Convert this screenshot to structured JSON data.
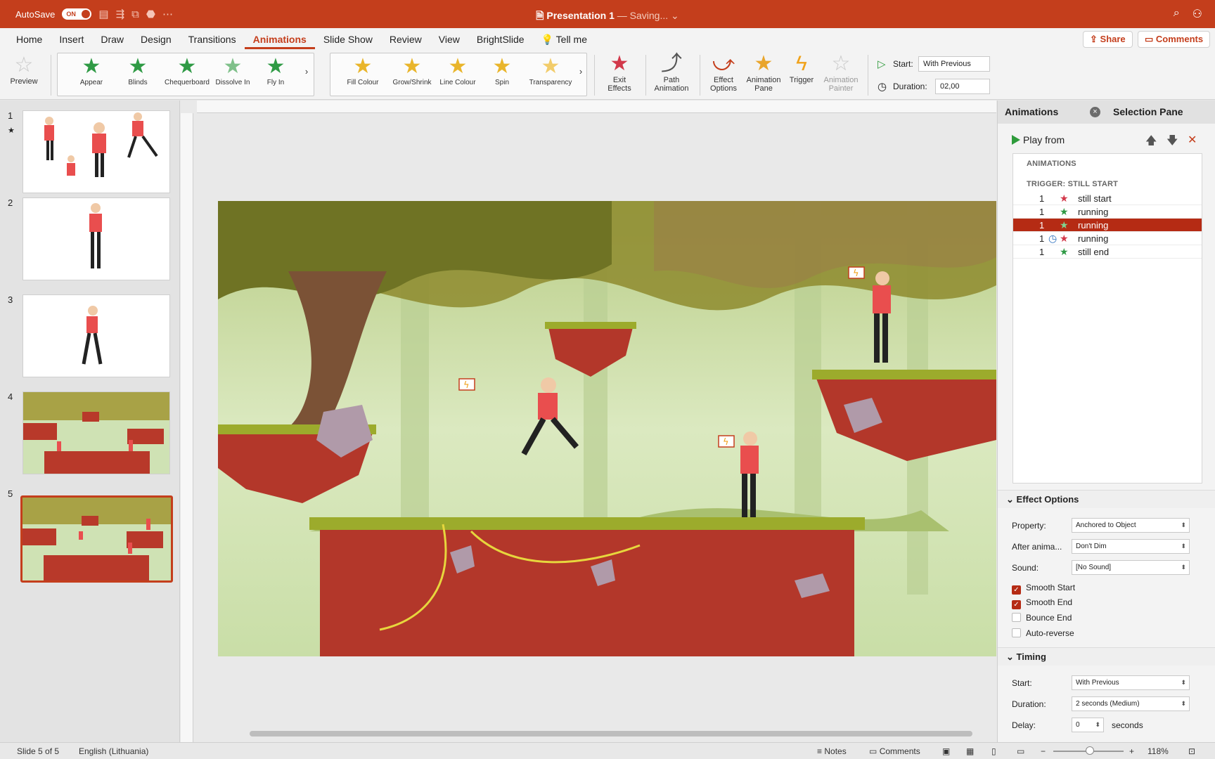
{
  "titlebar": {
    "autosave_label": "AutoSave",
    "autosave_state": "ON",
    "doc_title": "Presentation 1",
    "save_status": "— Saving...",
    "brand_color": "#c43e1c"
  },
  "menu": {
    "tabs": [
      "Home",
      "Insert",
      "Draw",
      "Design",
      "Transitions",
      "Animations",
      "Slide Show",
      "Review",
      "View",
      "BrightSlide",
      "Tell me"
    ],
    "active_tab": "Animations",
    "share_label": "Share",
    "comments_label": "Comments"
  },
  "ribbon": {
    "preview_label": "Preview",
    "entrance_effects": [
      "Appear",
      "Blinds",
      "Chequerboard",
      "Dissolve In",
      "Fly In"
    ],
    "emphasis_effects": [
      "Fill Colour",
      "Grow/Shrink",
      "Line Colour",
      "Spin",
      "Transparency"
    ],
    "exit_label_1": "Exit",
    "exit_label_2": "Effects",
    "path_label_1": "Path",
    "path_label_2": "Animation",
    "effect_options_1": "Effect",
    "effect_options_2": "Options",
    "animation_pane_1": "Animation",
    "animation_pane_2": "Pane",
    "trigger_label": "Trigger",
    "painter_1": "Animation",
    "painter_2": "Painter",
    "start_label": "Start:",
    "start_value": "With Previous",
    "duration_label": "Duration:",
    "duration_value": "02,00"
  },
  "slides": {
    "numbers": [
      "1",
      "2",
      "3",
      "4",
      "5"
    ],
    "selected": "5"
  },
  "pane": {
    "tab_animations": "Animations",
    "tab_selection": "Selection Pane",
    "play_from": "Play from",
    "list_header": "ANIMATIONS",
    "trigger_header": "TRIGGER: STILL START",
    "items": [
      {
        "num": "1",
        "label": "still start",
        "icon": "exit-star-icon"
      },
      {
        "num": "1",
        "label": "running",
        "icon": "entrance-star-icon"
      },
      {
        "num": "1",
        "label": "running",
        "icon": "entrance-star-icon",
        "selected": true
      },
      {
        "num": "1",
        "label": "running",
        "icon": "clock-exit-icon"
      },
      {
        "num": "1",
        "label": "still end",
        "icon": "entrance-star-icon"
      }
    ],
    "effect_options_title": "Effect Options",
    "property_label": "Property:",
    "property_value": "Anchored to Object",
    "after_label": "After anima...",
    "after_value": "Don't Dim",
    "sound_label": "Sound:",
    "sound_value": "[No Sound]",
    "smooth_start": "Smooth Start",
    "smooth_end": "Smooth End",
    "bounce_end": "Bounce End",
    "auto_reverse": "Auto-reverse",
    "timing_title": "Timing",
    "timing_start_label": "Start:",
    "timing_start_value": "With Previous",
    "timing_duration_label": "Duration:",
    "timing_duration_value": "2 seconds (Medium)",
    "delay_label": "Delay:",
    "delay_value": "0",
    "delay_unit": "seconds"
  },
  "status": {
    "slide_info": "Slide 5 of 5",
    "language": "English (Lithuania)",
    "notes": "Notes",
    "comments": "Comments",
    "zoom": "118%"
  }
}
